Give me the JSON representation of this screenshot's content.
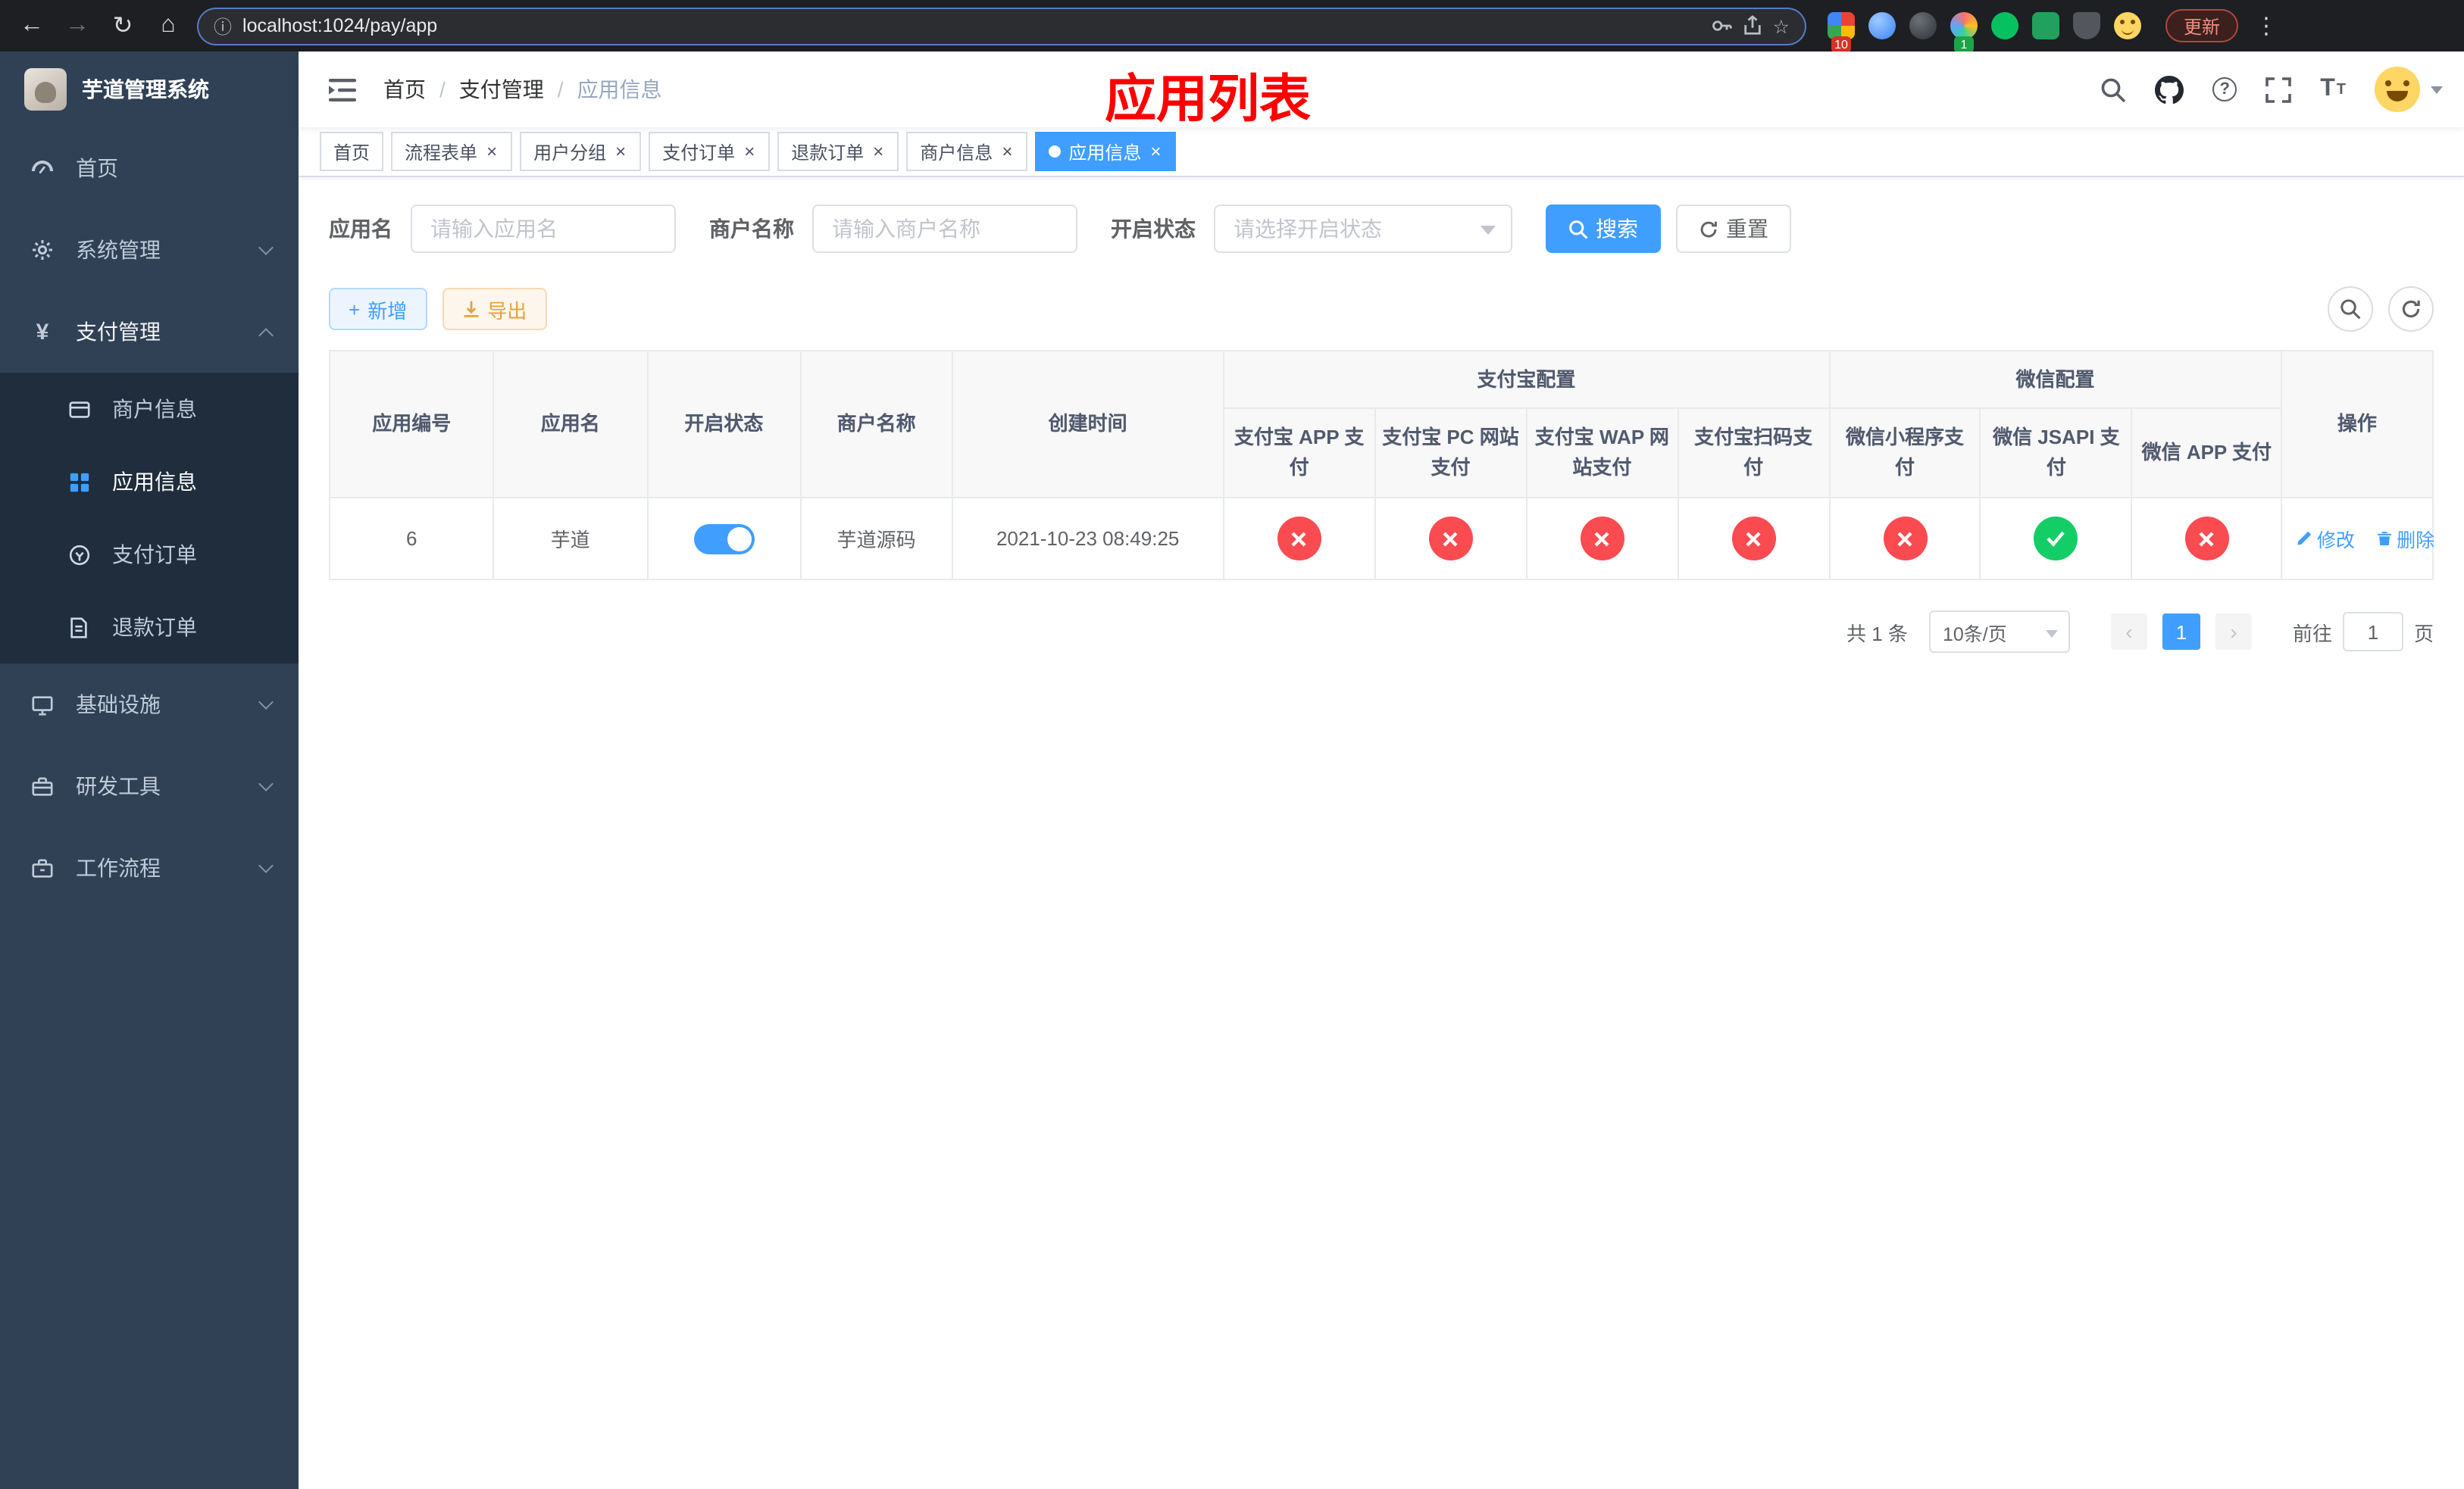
{
  "browser": {
    "url": "localhost:1024/pay/app",
    "update_button": "更新",
    "extension_badge_count": "10",
    "extension_badge_count2": "1"
  },
  "icons": {
    "back": "←",
    "forward": "→",
    "reload": "↻",
    "home": "⌂",
    "info": "ⓘ",
    "star": "☆",
    "menu_dots": "⋮",
    "breadcrumb_separator": "/",
    "tab_close": "×",
    "plus": "+",
    "page_prev": "‹",
    "page_next": "›",
    "question": "?",
    "font_size": "T"
  },
  "sidebar": {
    "title": "芋道管理系统",
    "items": {
      "home": "首页",
      "system": "系统管理",
      "payment": "支付管理",
      "merchant_info": "商户信息",
      "app_info": "应用信息",
      "pay_order": "支付订单",
      "refund_order": "退款订单",
      "infrastructure": "基础设施",
      "dev_tools": "研发工具",
      "workflow": "工作流程"
    }
  },
  "navbar": {
    "breadcrumb": [
      "首页",
      "支付管理",
      "应用信息"
    ],
    "page_title": "应用列表"
  },
  "tabs": [
    {
      "label": "首页",
      "closable": false,
      "active": false
    },
    {
      "label": "流程表单",
      "closable": true,
      "active": false
    },
    {
      "label": "用户分组",
      "closable": true,
      "active": false
    },
    {
      "label": "支付订单",
      "closable": true,
      "active": false
    },
    {
      "label": "退款订单",
      "closable": true,
      "active": false
    },
    {
      "label": "商户信息",
      "closable": true,
      "active": false
    },
    {
      "label": "应用信息",
      "closable": true,
      "active": true
    }
  ],
  "filters": {
    "app_name_label": "应用名",
    "app_name_placeholder": "请输入应用名",
    "merchant_label": "商户名称",
    "merchant_placeholder": "请输入商户名称",
    "status_label": "开启状态",
    "status_placeholder": "请选择开启状态",
    "search": "搜索",
    "reset": "重置"
  },
  "toolbar": {
    "add": "新增",
    "export": "导出"
  },
  "table": {
    "headers": {
      "app_id": "应用编号",
      "app_name": "应用名",
      "status": "开启状态",
      "merchant_name": "商户名称",
      "create_time": "创建时间",
      "alipay_group": "支付宝配置",
      "wechat_group": "微信配置",
      "alipay_app": "支付宝 APP 支付",
      "alipay_pc": "支付宝 PC 网站支付",
      "alipay_wap": "支付宝 WAP 网站支付",
      "alipay_qr": "支付宝扫码支付",
      "wechat_mini": "微信小程序支付",
      "wechat_jsapi": "微信 JSAPI 支付",
      "wechat_app": "微信 APP 支付",
      "actions": "操作"
    },
    "rows": [
      {
        "app_id": "6",
        "app_name": "芋道",
        "status_enabled": true,
        "merchant_name": "芋道源码",
        "create_time": "2021-10-23 08:49:25",
        "alipay_app": false,
        "alipay_pc": false,
        "alipay_wap": false,
        "alipay_qr": false,
        "wechat_mini": false,
        "wechat_jsapi": true,
        "wechat_app": false,
        "action_edit": "修改",
        "action_delete": "删除"
      }
    ]
  },
  "pagination": {
    "total": "共 1 条",
    "page_size": "10条/页",
    "current_page": "1",
    "goto_label": "前往",
    "goto_value": "1",
    "goto_suffix": "页"
  },
  "colors": {
    "primary": "#409eff",
    "danger": "#fa4b50",
    "success": "#13ce66",
    "warning": "#e6a23c",
    "title_red": "#ff0000",
    "sidebar_bg": "#304156",
    "submenu_bg": "#1f2d3d"
  }
}
